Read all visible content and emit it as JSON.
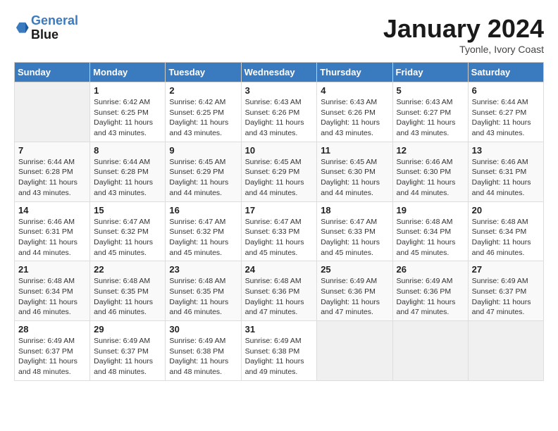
{
  "logo": {
    "line1": "General",
    "line2": "Blue"
  },
  "title": "January 2024",
  "subtitle": "Tyonle, Ivory Coast",
  "days_header": [
    "Sunday",
    "Monday",
    "Tuesday",
    "Wednesday",
    "Thursday",
    "Friday",
    "Saturday"
  ],
  "weeks": [
    [
      {
        "day": "",
        "info": ""
      },
      {
        "day": "1",
        "info": "Sunrise: 6:42 AM\nSunset: 6:25 PM\nDaylight: 11 hours\nand 43 minutes."
      },
      {
        "day": "2",
        "info": "Sunrise: 6:42 AM\nSunset: 6:25 PM\nDaylight: 11 hours\nand 43 minutes."
      },
      {
        "day": "3",
        "info": "Sunrise: 6:43 AM\nSunset: 6:26 PM\nDaylight: 11 hours\nand 43 minutes."
      },
      {
        "day": "4",
        "info": "Sunrise: 6:43 AM\nSunset: 6:26 PM\nDaylight: 11 hours\nand 43 minutes."
      },
      {
        "day": "5",
        "info": "Sunrise: 6:43 AM\nSunset: 6:27 PM\nDaylight: 11 hours\nand 43 minutes."
      },
      {
        "day": "6",
        "info": "Sunrise: 6:44 AM\nSunset: 6:27 PM\nDaylight: 11 hours\nand 43 minutes."
      }
    ],
    [
      {
        "day": "7",
        "info": "Sunrise: 6:44 AM\nSunset: 6:28 PM\nDaylight: 11 hours\nand 43 minutes."
      },
      {
        "day": "8",
        "info": "Sunrise: 6:44 AM\nSunset: 6:28 PM\nDaylight: 11 hours\nand 43 minutes."
      },
      {
        "day": "9",
        "info": "Sunrise: 6:45 AM\nSunset: 6:29 PM\nDaylight: 11 hours\nand 44 minutes."
      },
      {
        "day": "10",
        "info": "Sunrise: 6:45 AM\nSunset: 6:29 PM\nDaylight: 11 hours\nand 44 minutes."
      },
      {
        "day": "11",
        "info": "Sunrise: 6:45 AM\nSunset: 6:30 PM\nDaylight: 11 hours\nand 44 minutes."
      },
      {
        "day": "12",
        "info": "Sunrise: 6:46 AM\nSunset: 6:30 PM\nDaylight: 11 hours\nand 44 minutes."
      },
      {
        "day": "13",
        "info": "Sunrise: 6:46 AM\nSunset: 6:31 PM\nDaylight: 11 hours\nand 44 minutes."
      }
    ],
    [
      {
        "day": "14",
        "info": "Sunrise: 6:46 AM\nSunset: 6:31 PM\nDaylight: 11 hours\nand 44 minutes."
      },
      {
        "day": "15",
        "info": "Sunrise: 6:47 AM\nSunset: 6:32 PM\nDaylight: 11 hours\nand 45 minutes."
      },
      {
        "day": "16",
        "info": "Sunrise: 6:47 AM\nSunset: 6:32 PM\nDaylight: 11 hours\nand 45 minutes."
      },
      {
        "day": "17",
        "info": "Sunrise: 6:47 AM\nSunset: 6:33 PM\nDaylight: 11 hours\nand 45 minutes."
      },
      {
        "day": "18",
        "info": "Sunrise: 6:47 AM\nSunset: 6:33 PM\nDaylight: 11 hours\nand 45 minutes."
      },
      {
        "day": "19",
        "info": "Sunrise: 6:48 AM\nSunset: 6:34 PM\nDaylight: 11 hours\nand 45 minutes."
      },
      {
        "day": "20",
        "info": "Sunrise: 6:48 AM\nSunset: 6:34 PM\nDaylight: 11 hours\nand 46 minutes."
      }
    ],
    [
      {
        "day": "21",
        "info": "Sunrise: 6:48 AM\nSunset: 6:34 PM\nDaylight: 11 hours\nand 46 minutes."
      },
      {
        "day": "22",
        "info": "Sunrise: 6:48 AM\nSunset: 6:35 PM\nDaylight: 11 hours\nand 46 minutes."
      },
      {
        "day": "23",
        "info": "Sunrise: 6:48 AM\nSunset: 6:35 PM\nDaylight: 11 hours\nand 46 minutes."
      },
      {
        "day": "24",
        "info": "Sunrise: 6:48 AM\nSunset: 6:36 PM\nDaylight: 11 hours\nand 47 minutes."
      },
      {
        "day": "25",
        "info": "Sunrise: 6:49 AM\nSunset: 6:36 PM\nDaylight: 11 hours\nand 47 minutes."
      },
      {
        "day": "26",
        "info": "Sunrise: 6:49 AM\nSunset: 6:36 PM\nDaylight: 11 hours\nand 47 minutes."
      },
      {
        "day": "27",
        "info": "Sunrise: 6:49 AM\nSunset: 6:37 PM\nDaylight: 11 hours\nand 47 minutes."
      }
    ],
    [
      {
        "day": "28",
        "info": "Sunrise: 6:49 AM\nSunset: 6:37 PM\nDaylight: 11 hours\nand 48 minutes."
      },
      {
        "day": "29",
        "info": "Sunrise: 6:49 AM\nSunset: 6:37 PM\nDaylight: 11 hours\nand 48 minutes."
      },
      {
        "day": "30",
        "info": "Sunrise: 6:49 AM\nSunset: 6:38 PM\nDaylight: 11 hours\nand 48 minutes."
      },
      {
        "day": "31",
        "info": "Sunrise: 6:49 AM\nSunset: 6:38 PM\nDaylight: 11 hours\nand 49 minutes."
      },
      {
        "day": "",
        "info": ""
      },
      {
        "day": "",
        "info": ""
      },
      {
        "day": "",
        "info": ""
      }
    ]
  ]
}
